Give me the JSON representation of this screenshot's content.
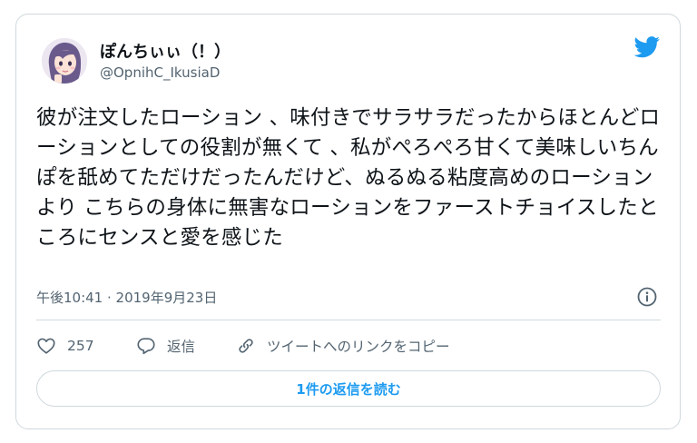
{
  "tweet": {
    "display_name": "ぽんちぃぃ（！）",
    "handle": "@OpnihC_IkusiaD",
    "text": "彼が注文したローション 、味付きでサラサラだったからほとんどローションとしての役割が無くて 、私がぺろぺろ甘くて美味しいちんぽを舐めてただけだったんだけど、ぬるぬる粘度高めのローションより こちらの身体に無害なローションをファーストチョイスしたところにセンスと愛を感じた",
    "timestamp": "午後10:41 · 2019年9月23日"
  },
  "actions": {
    "like_count": "257",
    "reply_label": "返信",
    "copy_link_label": "ツイートへのリンクをコピー"
  },
  "replies_button": "1件の返信を読む",
  "colors": {
    "accent": "#1d9bf0",
    "secondary_text": "#536471",
    "border": "#cfd9de"
  }
}
